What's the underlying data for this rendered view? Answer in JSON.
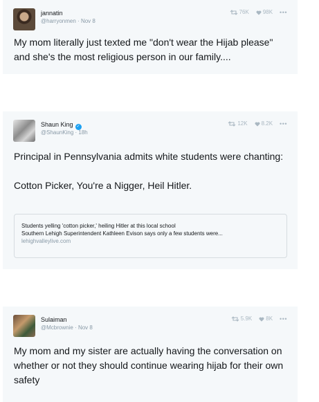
{
  "tweets": [
    {
      "name": "jannatin",
      "handle": "@harryonmen",
      "time": "Nov 8",
      "retweets": "76K",
      "likes": "98K",
      "more": "•••",
      "text": "My mom literally just texted me \"don't wear the Hijab please\" and she's the most religious person in our family...."
    },
    {
      "name": "Shaun King",
      "verified": true,
      "handle": "@ShaunKing",
      "time": "18h",
      "retweets": "12K",
      "likes": "8.2K",
      "more": "•••",
      "text": "Principal in Pennsylvania admits white students were chanting:\n\nCotton Picker, You're a Nigger, Heil Hitler.",
      "link_card": {
        "title": "Students yelling 'cotton picker,' heiling Hitler at this local school",
        "description": "Southern Lehigh Superintendent Kathleen Evison says only a few students were...",
        "domain": "lehighvalleylive.com"
      }
    },
    {
      "name": "Sulaiman",
      "handle": "@Mcbrownie",
      "time": "Nov 8",
      "retweets": "5.9K",
      "likes": "8K",
      "more": "•••",
      "text": "My mom and my sister are actually having the conversation on whether or not they should continue wearing hijab for their own safety"
    }
  ],
  "separator": "·",
  "colors": {
    "card_background": "#f5f8fa",
    "text": "#14171a",
    "muted": "#8899a6",
    "icon": "#aab8c2",
    "verified": "#1da1f2"
  },
  "icons": [
    "retweet-icon",
    "heart-icon",
    "more-icon",
    "verified-badge-icon"
  ]
}
